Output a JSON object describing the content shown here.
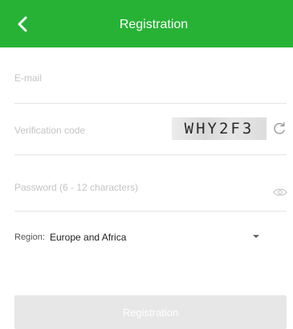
{
  "header": {
    "title": "Registration",
    "background_color": "#27b236"
  },
  "form": {
    "email": {
      "placeholder": "E-mail",
      "value": ""
    },
    "verification_code": {
      "placeholder": "Verification code",
      "value": "",
      "captcha_text": "WHY2F3"
    },
    "password": {
      "placeholder": "Password (6 - 12 characters)",
      "value": ""
    },
    "region": {
      "label": "Region:",
      "selected": "Europe and Africa"
    },
    "submit_label": "Registration"
  },
  "icons": {
    "back": "chevron-left-icon",
    "refresh": "refresh-icon",
    "eye": "eye-icon",
    "dropdown": "caret-down-icon"
  },
  "colors": {
    "accent": "#27b236",
    "disabled_button": "#e7e7e7",
    "divider": "#e4e4e4"
  }
}
